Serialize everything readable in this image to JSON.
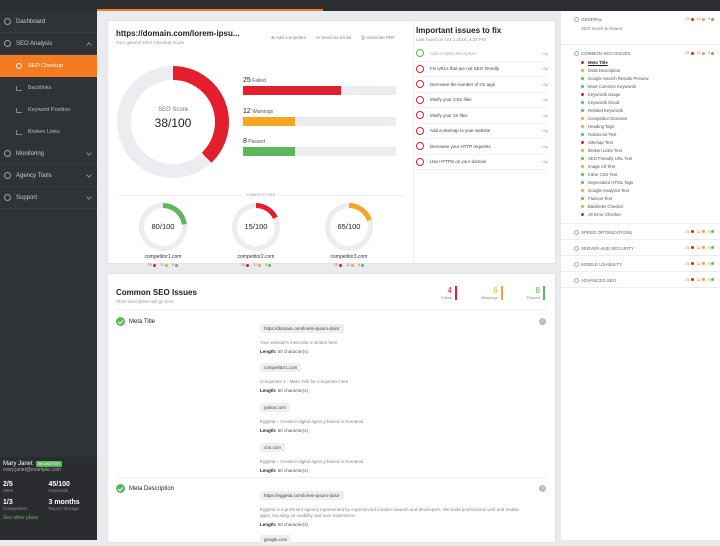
{
  "sidebar": {
    "dashboard": "Dashboard",
    "seo_analysis": "SEO Analysis",
    "seo_checkup": "SEO Checkup",
    "backlinks": "Backlinks",
    "keyword_position": "Keyword Position",
    "broken_links": "Broken Links",
    "monitoring": "Monitoring",
    "agency_tools": "Agency Tools",
    "support": "Support"
  },
  "user": {
    "name": "Mary Janet",
    "badge": "SEOMASTER",
    "email": "mary.janet@example.com",
    "sites_value": "2/5",
    "sites_label": "Sites",
    "keywords_value": "45/100",
    "keywords_label": "Keywords",
    "competitors_value": "1/3",
    "competitors_label": "Competitors",
    "storage_value": "3 months",
    "storage_label": "Report Storage",
    "upgrade": "See other plans"
  },
  "score_card": {
    "title": "https://domain.com/lorem-ipsu...",
    "subtitle": "Your general SEO Checkup Score",
    "add_competitor": "Add competitor",
    "send_email": "Send via Email",
    "generate_pdf": "Generate PDF",
    "score_label": "SEO Score",
    "score_value": "38/100",
    "score_fraction": 0.38,
    "failed_count": "25",
    "failed_label": "Failed",
    "failed_fraction": 0.64,
    "warnings_count": "12",
    "warnings_label": "Warnings",
    "warnings_fraction": 0.34,
    "passed_count": "8",
    "passed_label": "Passed",
    "passed_fraction": 0.34,
    "competitors_label": "COMPETITORS",
    "competitors": [
      {
        "name": "competitor1.com",
        "score": "80/100",
        "f": "25",
        "w": "12",
        "p": "8"
      },
      {
        "name": "competitor2.com",
        "score": "15/100",
        "f": "25",
        "w": "12",
        "p": "8"
      },
      {
        "name": "competitor3.com",
        "score": "65/100",
        "f": "25",
        "w": "12",
        "p": "8"
      }
    ]
  },
  "important": {
    "title": "Important issues to fix",
    "subtitle": "Last found on Oct 1 2016, 4:37 PM",
    "items": [
      {
        "text": "Add a meta description",
        "pts": "+3p"
      },
      {
        "text": "Fix URLs that are not SEO friendly",
        "pts": "+3p"
      },
      {
        "text": "Decrease the number of H1 tags",
        "pts": "+3p"
      },
      {
        "text": "Minify your CSS files",
        "pts": "+3p"
      },
      {
        "text": "Minify your JS files",
        "pts": "+3p"
      },
      {
        "text": "Add a sitemap to your website",
        "pts": "+3p"
      },
      {
        "text": "Decrease your HTTP requests",
        "pts": "+4p"
      },
      {
        "text": "Use HTTPS on your domain",
        "pts": "+4p"
      }
    ]
  },
  "common": {
    "title": "Common SEO Issues",
    "subtitle": "Short description will go here",
    "failed_count": "4",
    "failed_label": "Failed",
    "warnings_count": "6",
    "warnings_label": "Warnings",
    "passed_count": "8",
    "passed_label": "Passed",
    "meta_title": "Meta Title",
    "meta_description": "Meta Description",
    "length_label": "Length:",
    "entries": [
      {
        "url": "https://domain.com/lorem-ipsum-dolor",
        "desc": "Your website's meta title is written here",
        "len": "50 character(s)"
      },
      {
        "url": "competitor1.com",
        "desc": "Competitor 1 - Meta Title for competitor here",
        "len": "50 character(s)"
      },
      {
        "url": "yahoo.com",
        "desc": "Eggetia – Creative digital agency based in Romania",
        "len": "50 character(s)"
      },
      {
        "url": "cnn.com",
        "desc": "Eggetia – Creative digital agency based in Romania",
        "len": "50 character(s)"
      }
    ],
    "desc_entries": [
      {
        "url": "https://eggetia.com/lorem-ipsum-dolor",
        "desc": "Eggetia is a proficient agency represented by experienced creative awards and developers. We build professional web and mobile apps, focusing on usability and user experience.",
        "len": "50 character(s)"
      },
      {
        "url": "google.com"
      }
    ]
  },
  "right_panel": {
    "general": "GENERAL",
    "general_sub": "SEO Score & Issues",
    "common": "COMMON SEO ISSUES",
    "speed": "SPEED OPTIMIZATIONS",
    "server": "SERVER AND SECURITY",
    "mobile": "MOBILE USABILITY",
    "advanced": "ADVANCED SEO",
    "counts": {
      "f": "25",
      "w": "12",
      "p": "5"
    },
    "items": [
      {
        "t": "Meta Title",
        "c": "#e31e2d"
      },
      {
        "t": "Meta Description",
        "c": "#f5a623"
      },
      {
        "t": "Google Search Results Preview",
        "c": "#5cb85c"
      },
      {
        "t": "Most Common Keywords",
        "c": "#5cb85c"
      },
      {
        "t": "Keywords Usage",
        "c": "#e31e2d"
      },
      {
        "t": "Keywords Cloud",
        "c": "#5cb85c"
      },
      {
        "t": "Related Keywords",
        "c": "#5cb85c"
      },
      {
        "t": "Competitor Domains",
        "c": "#f5a623"
      },
      {
        "t": "Heading Tags",
        "c": "#f5a623"
      },
      {
        "t": "Robots.txt Test",
        "c": "#5cb85c"
      },
      {
        "t": "Sitemap Test",
        "c": "#e31e2d"
      },
      {
        "t": "Broken Links Test",
        "c": "#f5a623"
      },
      {
        "t": "SEO Friendly URL Test",
        "c": "#5cb85c"
      },
      {
        "t": "Image Alt Test",
        "c": "#f5a623"
      },
      {
        "t": "Inline CSS Test",
        "c": "#5cb85c"
      },
      {
        "t": "Deprecated HTML Tags",
        "c": "#5cb85c"
      },
      {
        "t": "Google Analytics Test",
        "c": "#f5a623"
      },
      {
        "t": "Favicon Test",
        "c": "#5cb85c"
      },
      {
        "t": "Backlinks Checker",
        "c": "#f5a623"
      },
      {
        "t": "JS Error Checker",
        "c": "#e31e2d"
      }
    ]
  },
  "colors": {
    "failed": "#e31e2d",
    "warning": "#f5a623",
    "passed": "#5cb85c",
    "accent": "#f47c20"
  }
}
